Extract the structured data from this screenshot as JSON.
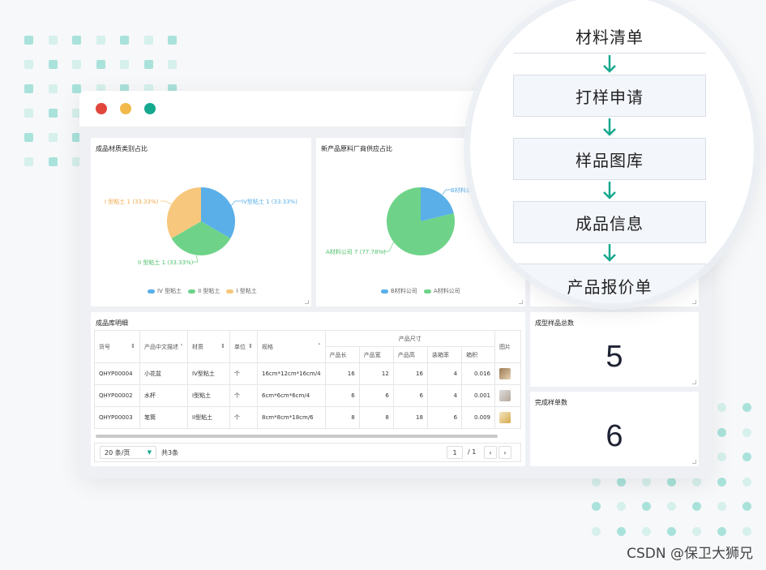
{
  "colors": {
    "red": "#e0463c",
    "yellow": "#f2b94a",
    "teal": "#16a88e",
    "blue": "#5aafe8",
    "green": "#6ed389",
    "orange": "#f6c77c",
    "dot_teal": "#7ed3c8"
  },
  "pie1": {
    "title": "成品材质类别占比",
    "labels": {
      "iv": "IV型粘土 1 (33.33%)",
      "i": "I 型粘土 1 (33.33%)",
      "ii": "II 型粘土 1 (33.33%)"
    },
    "legend": [
      "IV 型粘土",
      "II 型粘土",
      "I 型粘土"
    ]
  },
  "pie2": {
    "title": "新产品原料厂商供应占比",
    "labels": {
      "b": "B材料公",
      "a": "A材料公司 7 (77.78%)"
    },
    "legend": [
      "B材料公司",
      "A材料公司"
    ]
  },
  "table": {
    "title": "成品库明细",
    "headers": {
      "code": "货号",
      "desc": "产品中文描述",
      "material": "材质",
      "unit": "单位",
      "spec": "规格",
      "size_group": "产品尺寸",
      "len": "产品长",
      "wid": "产品宽",
      "hei": "产品高",
      "pack": "装箱率",
      "vol": "箱积",
      "img": "图片"
    },
    "rows": [
      {
        "code": "QHYP00004",
        "desc": "小花盆",
        "material": "IV型粘土",
        "unit": "个",
        "spec": "16cm*12cm*16cm/4",
        "len": "16",
        "wid": "12",
        "hei": "16",
        "pack": "4",
        "vol": "0.016"
      },
      {
        "code": "QHYP00002",
        "desc": "水杯",
        "material": "I型粘土",
        "unit": "个",
        "spec": "6cm*6cm*6cm/4",
        "len": "6",
        "wid": "6",
        "hei": "6",
        "pack": "4",
        "vol": "0.001"
      },
      {
        "code": "QHYP00003",
        "desc": "笔筒",
        "material": "II型粘土",
        "unit": "个",
        "spec": "8cm*8cm*18cm/6",
        "len": "8",
        "wid": "8",
        "hei": "18",
        "pack": "6",
        "vol": "0.009"
      }
    ],
    "page_size": "20 条/页",
    "total": "共3条",
    "page": "1",
    "page_total": "/ 1"
  },
  "stats": {
    "sample_title": "成型样品总数",
    "sample_value": "5",
    "done_title": "完成样单数",
    "done_value": "6"
  },
  "flow": [
    "材料清单",
    "打样申请",
    "样品图库",
    "成品信息",
    "产品报价单"
  ],
  "watermark": "CSDN @保卫大狮兄"
}
